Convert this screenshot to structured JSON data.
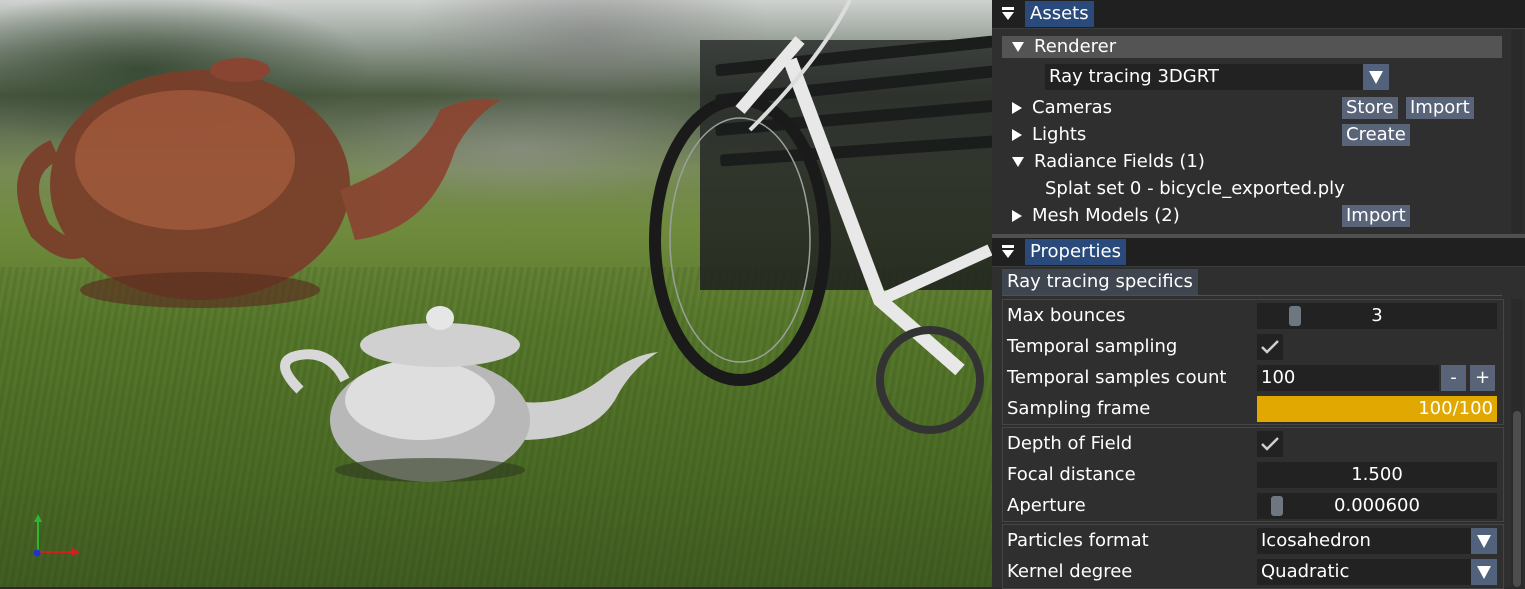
{
  "assets_window": {
    "title": "Assets",
    "renderer": {
      "label": "Renderer",
      "selected": "Ray tracing 3DGRT"
    },
    "tree": {
      "cameras": {
        "label": "Cameras",
        "store_label": "Store",
        "import_label": "Import"
      },
      "lights": {
        "label": "Lights",
        "create_label": "Create"
      },
      "radiance_fields": {
        "label": "Radiance Fields (1)",
        "child": "Splat set 0 - bicycle_exported.ply"
      },
      "mesh_models": {
        "label": "Mesh Models (2)",
        "import_label": "Import"
      }
    }
  },
  "properties_window": {
    "title": "Properties",
    "section_tab": "Ray tracing specifics",
    "max_bounces": {
      "label": "Max bounces",
      "value": "3"
    },
    "temporal_sampling": {
      "label": "Temporal sampling",
      "checked": true
    },
    "temporal_samples_count": {
      "label": "Temporal samples count",
      "value": "100",
      "minus": "-",
      "plus": "+"
    },
    "sampling_frame": {
      "label": "Sampling frame",
      "value": "100/100",
      "progress": 1.0
    },
    "depth_of_field": {
      "label": "Depth of Field",
      "checked": true
    },
    "focal_distance": {
      "label": "Focal distance",
      "value": "1.500"
    },
    "aperture": {
      "label": "Aperture",
      "value": "0.000600"
    },
    "particles_format": {
      "label": "Particles format",
      "value": "Icosahedron"
    },
    "kernel_degree": {
      "label": "Kernel degree",
      "value": "Quadratic"
    }
  },
  "colors": {
    "tab_active": "#294a7a",
    "button": "#5a6478",
    "progress": "#e0a800",
    "panel_bg": "#2f2f2f",
    "field_bg": "#222222"
  },
  "icons": [
    "collapse-icon",
    "tree-arrow-icon",
    "dropdown-arrow-icon",
    "checkmark-icon",
    "axis-gizmo-icon"
  ]
}
